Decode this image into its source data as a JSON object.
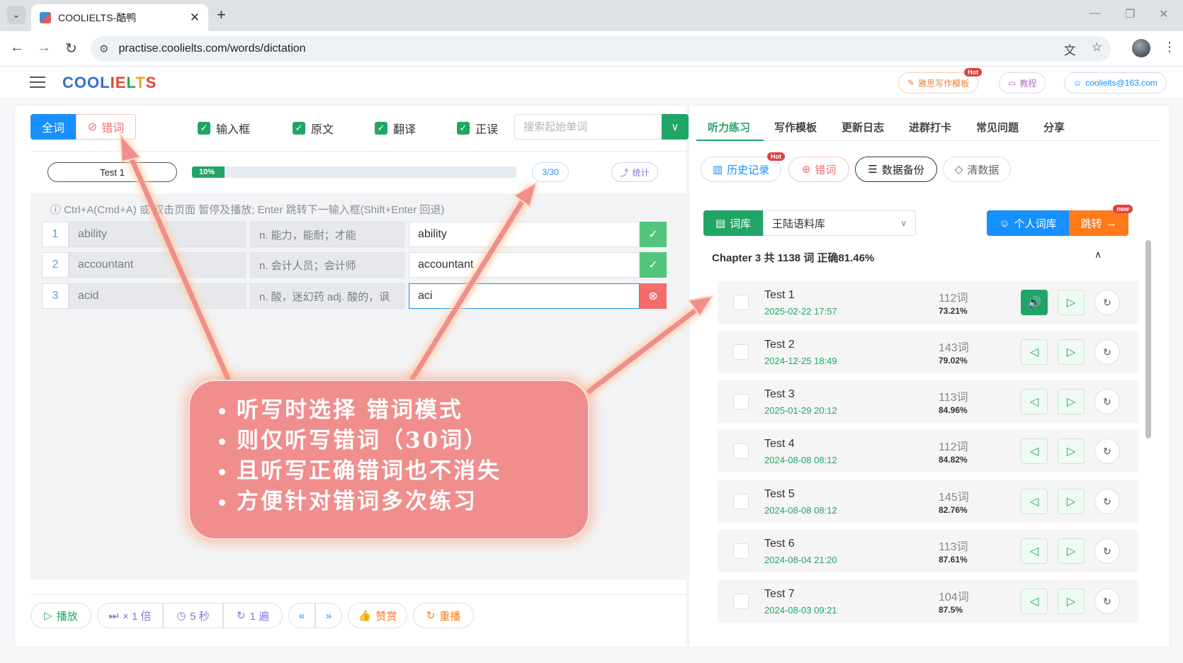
{
  "browser": {
    "tab_title": "COOLIELTS-酷鸭",
    "url": "practise.coolielts.com/words/dictation"
  },
  "app": {
    "logo_text": "COOLIELTS",
    "header_buttons": {
      "writing_template": "雅思写作模板",
      "writing_badge": "Hot",
      "tutorial": "教程",
      "user": "coolielts@163.com"
    }
  },
  "left": {
    "mode": {
      "all": "全词",
      "wrong": "错词"
    },
    "checks": [
      "输入框",
      "原文",
      "翻译",
      "正误"
    ],
    "search_placeholder": "搜索起始单词",
    "test_select": "Test 1",
    "progress": {
      "label": "10%",
      "percent": 10
    },
    "counter": "3/30",
    "stats_label": "统计",
    "hint": "Ctrl+A(Cmd+A) 或 双击页面 暂停及播放; Enter 跳转下一输入框(Shift+Enter 回退)",
    "rows": [
      {
        "num": "1",
        "word": "ability",
        "trans": "n. 能力，能耐；才能",
        "input": "ability",
        "status": "correct"
      },
      {
        "num": "2",
        "word": "accountant",
        "trans": "n. 会计人员；会计师",
        "input": "accountant",
        "status": "correct"
      },
      {
        "num": "3",
        "word": "acid",
        "trans": "n. 酸，迷幻药 adj. 酸的，讽",
        "input": "aci",
        "status": "wrong"
      }
    ],
    "controls": {
      "play": "播放",
      "speed": "× 1 倍",
      "interval": "5 秒",
      "repeat": "1 遍",
      "prev": "«",
      "next": "»",
      "like": "赞赏",
      "replay": "重播"
    }
  },
  "right": {
    "tabs": [
      "听力练习",
      "写作模板",
      "更新日志",
      "进群打卡",
      "常见问题",
      "分享"
    ],
    "pills": {
      "history": "历史记录",
      "history_badge": "Hot",
      "wrong": "错词",
      "backup": "数据备份",
      "clear": "清数据"
    },
    "library_label": "词库",
    "library_value": "王陆语料库",
    "personal_lib": "个人词库",
    "jump": "跳转",
    "jump_badge": "new",
    "chapter": "Chapter 3 共 1138 词 正确81.46%",
    "tests": [
      {
        "name": "Test 1",
        "date": "2025-02-22 17:57",
        "words": "112词",
        "rate": "73.21%",
        "playing": true
      },
      {
        "name": "Test 2",
        "date": "2024-12-25 18:49",
        "words": "143词",
        "rate": "79.02%",
        "playing": false
      },
      {
        "name": "Test 3",
        "date": "2025-01-29 20:12",
        "words": "113词",
        "rate": "84.96%",
        "playing": false
      },
      {
        "name": "Test 4",
        "date": "2024-08-08 08:12",
        "words": "112词",
        "rate": "84.82%",
        "playing": false
      },
      {
        "name": "Test 5",
        "date": "2024-08-08 08:12",
        "words": "145词",
        "rate": "82.76%",
        "playing": false
      },
      {
        "name": "Test 6",
        "date": "2024-08-04 21:20",
        "words": "113词",
        "rate": "87.61%",
        "playing": false
      },
      {
        "name": "Test 7",
        "date": "2024-08-03 09:21",
        "words": "104词",
        "rate": "87.5%",
        "playing": false
      }
    ]
  },
  "callout": [
    "听写时选择 错词模式",
    "则仅听写错词（30词）",
    "且听写正确错词也不消失",
    "方便针对错词多次练习"
  ],
  "colors": {
    "green": "#21a566",
    "blue": "#1890ff",
    "red": "#f56c6c",
    "orange": "#ff7a1a"
  }
}
